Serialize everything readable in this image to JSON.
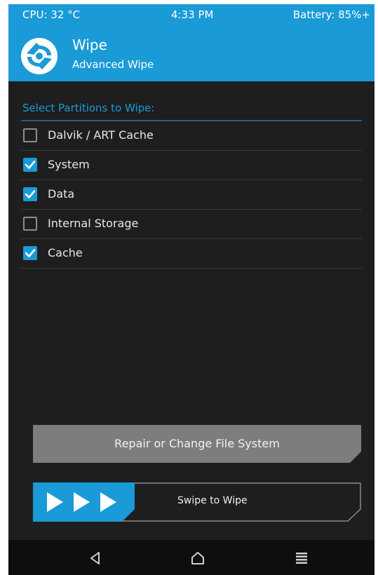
{
  "status_bar": {
    "cpu": "CPU: 32 °C",
    "time": "4:33 PM",
    "battery": "Battery: 85%+"
  },
  "header": {
    "icon": "twrp-logo-icon",
    "title": "Wipe",
    "subtitle": "Advanced Wipe"
  },
  "colors": {
    "accent": "#1a9ad6",
    "background": "#1e1e1e",
    "button": "#7d7d7d",
    "navbar": "#0e0e0e"
  },
  "partitions": {
    "label": "Select Partitions to Wipe:",
    "items": [
      {
        "label": "Dalvik / ART Cache",
        "checked": false
      },
      {
        "label": "System",
        "checked": true
      },
      {
        "label": "Data",
        "checked": true
      },
      {
        "label": "Internal Storage",
        "checked": false
      },
      {
        "label": "Cache",
        "checked": true
      }
    ]
  },
  "repair_button": {
    "label": "Repair or Change File System"
  },
  "swipe": {
    "label": "Swipe to Wipe",
    "handle_icon": "triple-arrow-right-icon"
  },
  "navbar": {
    "back_icon": "back-triangle-icon",
    "home_icon": "home-icon",
    "menu_icon": "menu-lines-icon"
  }
}
